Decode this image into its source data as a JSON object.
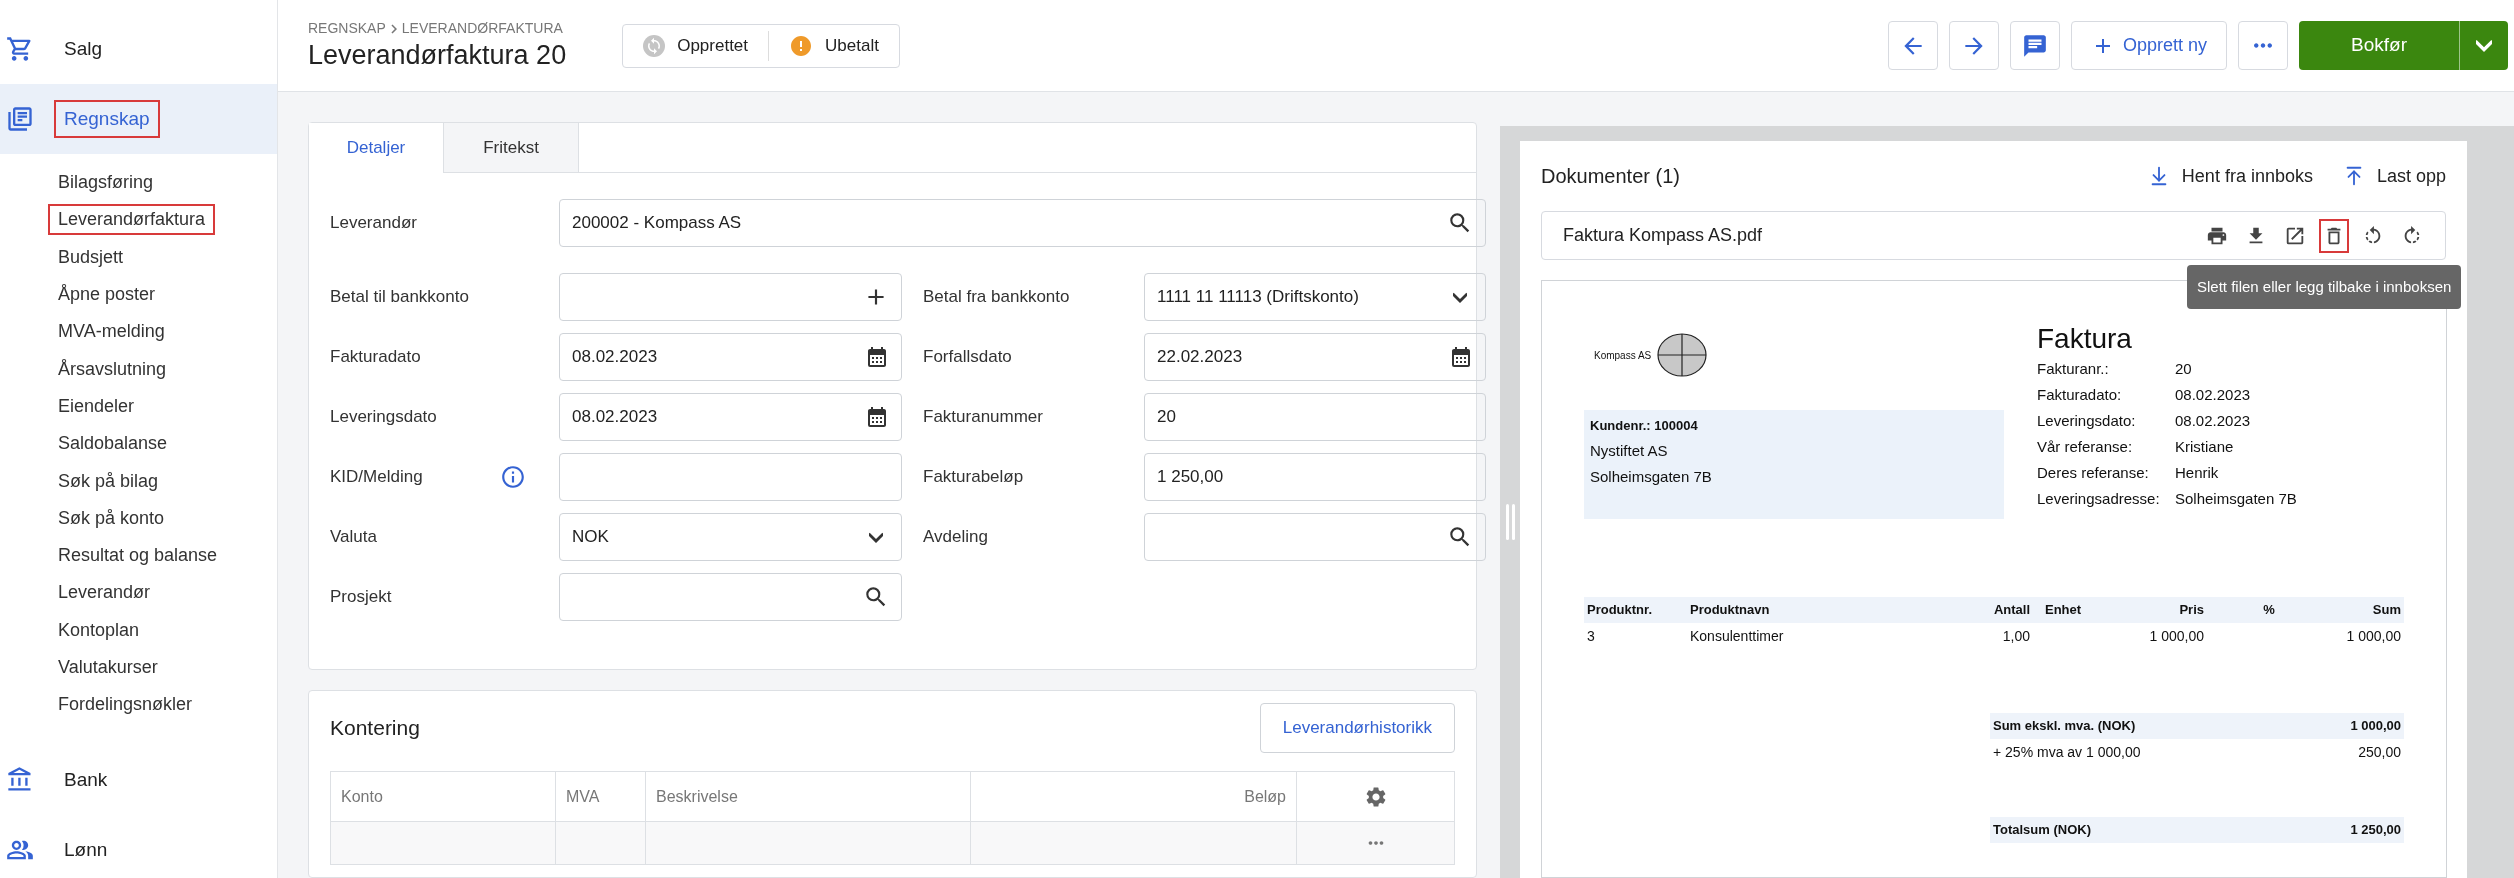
{
  "sidebar": {
    "items": [
      {
        "label": "Salg",
        "selected": false,
        "highlighted": false
      },
      {
        "label": "Regnskap",
        "selected": true,
        "highlighted": true,
        "children": [
          {
            "label": "Bilagsføring",
            "highlighted": false
          },
          {
            "label": "Leverandørfaktura",
            "highlighted": true
          },
          {
            "label": "Budsjett",
            "highlighted": false
          },
          {
            "label": "Åpne poster",
            "highlighted": false
          },
          {
            "label": "MVA-melding",
            "highlighted": false
          },
          {
            "label": "Årsavslutning",
            "highlighted": false
          },
          {
            "label": "Eiendeler",
            "highlighted": false
          },
          {
            "label": "Saldobalanse",
            "highlighted": false
          },
          {
            "label": "Søk på bilag",
            "highlighted": false
          },
          {
            "label": "Søk på konto",
            "highlighted": false
          },
          {
            "label": "Resultat og balanse",
            "highlighted": false
          },
          {
            "label": "Leverandør",
            "highlighted": false
          },
          {
            "label": "Kontoplan",
            "highlighted": false
          },
          {
            "label": "Valutakurser",
            "highlighted": false
          },
          {
            "label": "Fordelingsnøkler",
            "highlighted": false
          }
        ]
      },
      {
        "label": "Bank",
        "selected": false,
        "highlighted": false
      },
      {
        "label": "Lønn",
        "selected": false,
        "highlighted": false
      }
    ]
  },
  "header": {
    "breadcrumb": [
      "REGNSKAP",
      "LEVERANDØRFAKTURA"
    ],
    "title": "Leverandørfaktura 20",
    "statuses": [
      {
        "label": "Opprettet",
        "kind": "created"
      },
      {
        "label": "Ubetalt",
        "kind": "unpaid"
      }
    ],
    "create_button": "Opprett ny",
    "primary_button": "Bokfør"
  },
  "form": {
    "tabs": [
      {
        "label": "Detaljer",
        "selected": true
      },
      {
        "label": "Fritekst",
        "selected": false
      }
    ],
    "supplier": {
      "label": "Leverandør",
      "value": "200002 - Kompass AS",
      "kind": "search"
    },
    "rows": [
      [
        {
          "label": "Betal til bankkonto",
          "kind": "add"
        },
        {
          "label": "Betal fra bankkonto",
          "value": "1111 11 11113 (Driftskonto)",
          "kind": "select"
        }
      ],
      [
        {
          "label": "Fakturadato",
          "value": "08.02.2023",
          "kind": "date"
        },
        {
          "label": "Forfallsdato",
          "value": "22.02.2023",
          "kind": "date"
        }
      ],
      [
        {
          "label": "Leveringsdato",
          "value": "08.02.2023",
          "kind": "date"
        },
        {
          "label": "Fakturanummer",
          "value": "20",
          "kind": "text"
        }
      ],
      [
        {
          "label": "KID/Melding",
          "kind": "text",
          "info": true
        },
        {
          "label": "Fakturabeløp",
          "value": "1 250,00",
          "kind": "text"
        }
      ],
      [
        {
          "label": "Valuta",
          "value": "NOK",
          "kind": "select"
        },
        {
          "label": "Avdeling",
          "kind": "search"
        }
      ],
      [
        {
          "label": "Prosjekt",
          "kind": "search"
        }
      ]
    ]
  },
  "posting": {
    "title": "Kontering",
    "history_button": "Leverandørhistorikk",
    "columns": [
      "Konto",
      "MVA",
      "Beskrivelse",
      "Beløp"
    ]
  },
  "documents": {
    "title": "Dokumenter (1)",
    "actions": [
      {
        "label": "Hent fra innboks",
        "kind": "download"
      },
      {
        "label": "Last opp",
        "kind": "upload"
      }
    ],
    "file": {
      "name": "Faktura Kompass AS.pdf",
      "tools": [
        {
          "kind": "print",
          "highlighted": false
        },
        {
          "kind": "download",
          "highlighted": false
        },
        {
          "kind": "open",
          "highlighted": false
        },
        {
          "kind": "delete",
          "highlighted": true
        },
        {
          "kind": "rotate-left",
          "highlighted": false
        },
        {
          "kind": "rotate-right",
          "highlighted": false
        }
      ]
    },
    "tooltip": "Slett filen eller legg tilbake i innboksen",
    "preview": {
      "company": "Kompass AS",
      "customer": [
        "Kundenr.: 100004",
        "Nystiftet AS",
        "Solheimsgaten 7B"
      ],
      "title": "Faktura",
      "info": [
        [
          "Fakturanr.:",
          "20"
        ],
        [
          "Fakturadato:",
          "08.02.2023"
        ],
        [
          "Leveringsdato:",
          "08.02.2023"
        ],
        [
          "Vår referanse:",
          "Kristiane"
        ],
        [
          "Deres referanse:",
          "Henrik"
        ],
        [
          "Leveringsadresse:",
          "Solheimsgaten 7B"
        ]
      ],
      "columns": [
        "Produktnr.",
        "Produktnavn",
        "Antall",
        "Enhet",
        "Pris",
        "%",
        "Sum"
      ],
      "rows": [
        [
          "3",
          "Konsulenttimer",
          "1,00",
          "",
          "1 000,00",
          "",
          "1 000,00"
        ]
      ],
      "totals": [
        {
          "label": "Sum ekskl. mva. (NOK)",
          "value": "1 000,00",
          "bold": true,
          "gap_before": false
        },
        {
          "label": "+ 25% mva av 1 000,00",
          "value": "250,00",
          "bold": false,
          "gap_before": false
        },
        {
          "label": "Totalsum (NOK)",
          "value": "1 250,00",
          "bold": true,
          "gap_before": true
        }
      ]
    }
  }
}
